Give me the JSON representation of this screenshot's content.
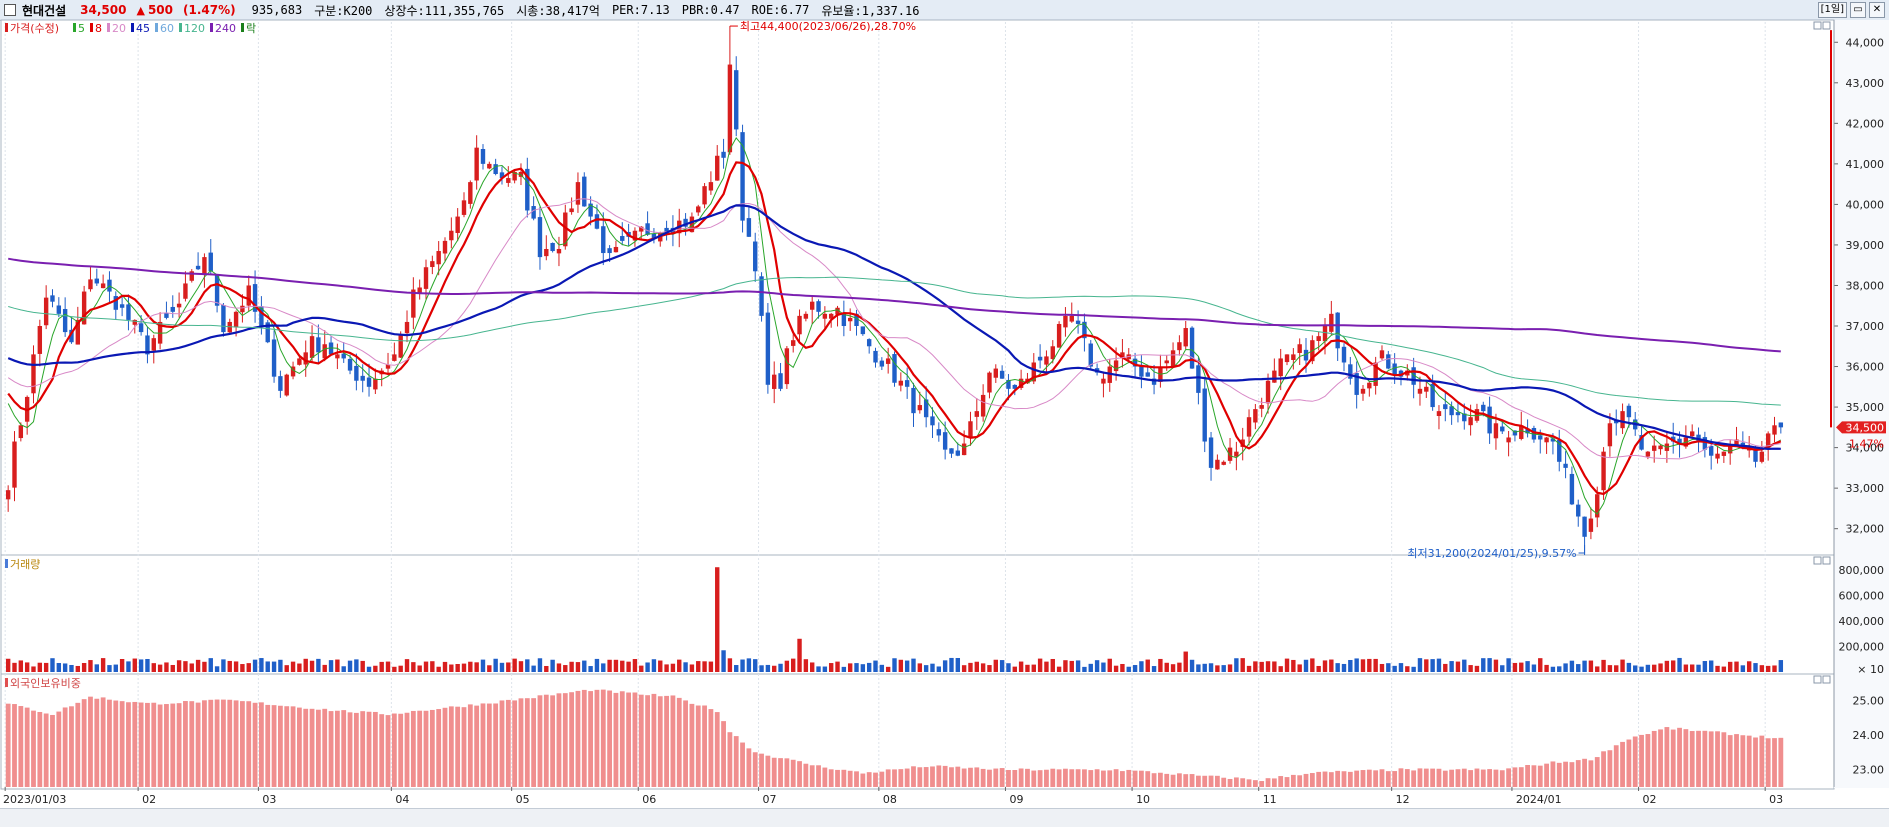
{
  "header": {
    "name": "현대건설",
    "price": "34,500",
    "up_arrow": "▲",
    "change": "500",
    "change_pct": "(1.47%)",
    "volume": "935,683",
    "info": [
      "구분:K200",
      "상장수:111,355,765",
      "시총:38,417억",
      "PER:7.13",
      "PBR:0.47",
      "ROE:6.77",
      "유보율:1,337.16"
    ],
    "period_button": "[1일]",
    "window_buttons": [
      "▭",
      "✕"
    ]
  },
  "legend": {
    "items": [
      {
        "label": "가격(수정)",
        "color": "#d81e1e"
      },
      {
        "label": "5",
        "color": "#2aa62a"
      },
      {
        "label": "8",
        "color": "#e00000"
      },
      {
        "label": "20",
        "color": "#d889c7"
      },
      {
        "label": "45",
        "color": "#0a18b4"
      },
      {
        "label": "60",
        "color": "#6fa8dc"
      },
      {
        "label": "120",
        "color": "#47b58f"
      },
      {
        "label": "240",
        "color": "#7a1fb0"
      },
      {
        "label": "락",
        "color": "#1a7f1a"
      }
    ]
  },
  "chart_data": [
    {
      "type": "candlestick",
      "title": "가격(수정)",
      "ylim": [
        31400,
        44500
      ],
      "y_ticks": [
        "44,000",
        "43,000",
        "42,000",
        "41,000",
        "40,000",
        "39,000",
        "38,000",
        "37,000",
        "36,000",
        "35,000",
        "34,000",
        "33,000",
        "32,000"
      ],
      "x_ticks": [
        "2023/01/03",
        "02",
        "03",
        "04",
        "05",
        "06",
        "07",
        "08",
        "09",
        "10",
        "11",
        "12",
        "2024/01",
        "02",
        "03"
      ],
      "x_tick_positions": [
        0,
        21,
        40,
        61,
        80,
        100,
        119,
        138,
        158,
        178,
        198,
        219,
        238,
        258,
        278
      ],
      "n_days": 281,
      "anchors": [
        [
          0,
          33200
        ],
        [
          3,
          35400
        ],
        [
          6,
          37800
        ],
        [
          10,
          36500
        ],
        [
          13,
          38300
        ],
        [
          17,
          37600
        ],
        [
          22,
          36500
        ],
        [
          27,
          37500
        ],
        [
          31,
          38800
        ],
        [
          34,
          37000
        ],
        [
          38,
          37800
        ],
        [
          43,
          35500
        ],
        [
          47,
          36500
        ],
        [
          50,
          36600
        ],
        [
          53,
          36000
        ],
        [
          57,
          35600
        ],
        [
          61,
          36300
        ],
        [
          64,
          37700
        ],
        [
          68,
          38800
        ],
        [
          72,
          39900
        ],
        [
          74,
          41300
        ],
        [
          77,
          40800
        ],
        [
          81,
          40600
        ],
        [
          84,
          38900
        ],
        [
          87,
          39100
        ],
        [
          90,
          40500
        ],
        [
          95,
          38600
        ],
        [
          100,
          39300
        ],
        [
          104,
          39500
        ],
        [
          108,
          39600
        ],
        [
          111,
          40700
        ],
        [
          113,
          41300
        ],
        [
          114,
          43500
        ],
        [
          116,
          39800
        ],
        [
          118,
          38600
        ],
        [
          120,
          35500
        ],
        [
          122,
          35700
        ],
        [
          124,
          36800
        ],
        [
          127,
          37500
        ],
        [
          131,
          37400
        ],
        [
          135,
          36700
        ],
        [
          139,
          36000
        ],
        [
          143,
          35100
        ],
        [
          148,
          33800
        ],
        [
          151,
          34000
        ],
        [
          155,
          35900
        ],
        [
          159,
          35400
        ],
        [
          163,
          36200
        ],
        [
          168,
          37200
        ],
        [
          172,
          35800
        ],
        [
          176,
          36200
        ],
        [
          181,
          35700
        ],
        [
          186,
          36800
        ],
        [
          190,
          33600
        ],
        [
          194,
          34000
        ],
        [
          197,
          35000
        ],
        [
          201,
          36000
        ],
        [
          206,
          36500
        ],
        [
          209,
          37100
        ],
        [
          213,
          35500
        ],
        [
          217,
          36200
        ],
        [
          222,
          35700
        ],
        [
          226,
          34800
        ],
        [
          231,
          34900
        ],
        [
          235,
          34400
        ],
        [
          240,
          34500
        ],
        [
          244,
          34100
        ],
        [
          247,
          32800
        ],
        [
          249,
          31900
        ],
        [
          251,
          33100
        ],
        [
          253,
          34800
        ],
        [
          256,
          34600
        ],
        [
          259,
          33700
        ],
        [
          263,
          34100
        ],
        [
          266,
          34400
        ],
        [
          269,
          33700
        ],
        [
          273,
          34000
        ],
        [
          276,
          33700
        ],
        [
          280,
          34500
        ]
      ],
      "high_annotation": "최고44,400(2023/06/26),28.70%",
      "low_annotation": "최저31,200(2024/01/25),9.57%",
      "last_price_tag": "34,500",
      "last_pct_tag": "1.47%",
      "ma_periods": [
        5,
        8,
        20,
        45,
        120,
        240
      ],
      "colors": {
        "up": "#d81e1e",
        "down": "#1f5fc8"
      }
    },
    {
      "type": "bar",
      "title": "거래량",
      "ylim": [
        0,
        900000
      ],
      "y_ticks": [
        "800,000",
        "600,000",
        "400,000",
        "200,000"
      ],
      "unit_label": "× 10",
      "spikes": [
        [
          112,
          820000
        ],
        [
          113,
          170000
        ],
        [
          125,
          260000
        ],
        [
          186,
          160000
        ],
        [
          264,
          110000
        ],
        [
          269,
          90000
        ]
      ],
      "typical_range": [
        40000,
        110000
      ]
    },
    {
      "type": "bar",
      "title": "외국인보유비중",
      "ylim": [
        22.5,
        25.7
      ],
      "y_ticks": [
        "25.00",
        "24.00",
        "23.00"
      ],
      "anchors": [
        [
          0,
          24.9
        ],
        [
          7,
          24.6
        ],
        [
          13,
          25.1
        ],
        [
          22,
          24.9
        ],
        [
          35,
          25.0
        ],
        [
          52,
          24.7
        ],
        [
          60,
          24.6
        ],
        [
          75,
          24.9
        ],
        [
          92,
          25.3
        ],
        [
          105,
          25.1
        ],
        [
          112,
          24.7
        ],
        [
          114,
          24.1
        ],
        [
          118,
          23.5
        ],
        [
          128,
          23.1
        ],
        [
          135,
          22.9
        ],
        [
          145,
          23.1
        ],
        [
          158,
          23.0
        ],
        [
          175,
          23.0
        ],
        [
          190,
          22.8
        ],
        [
          198,
          22.7
        ],
        [
          205,
          22.9
        ],
        [
          220,
          23.0
        ],
        [
          236,
          23.0
        ],
        [
          244,
          23.2
        ],
        [
          250,
          23.3
        ],
        [
          256,
          23.9
        ],
        [
          262,
          24.2
        ],
        [
          268,
          24.1
        ],
        [
          274,
          24.0
        ],
        [
          280,
          23.9
        ]
      ],
      "bar_color": "#f08e8e"
    }
  ]
}
